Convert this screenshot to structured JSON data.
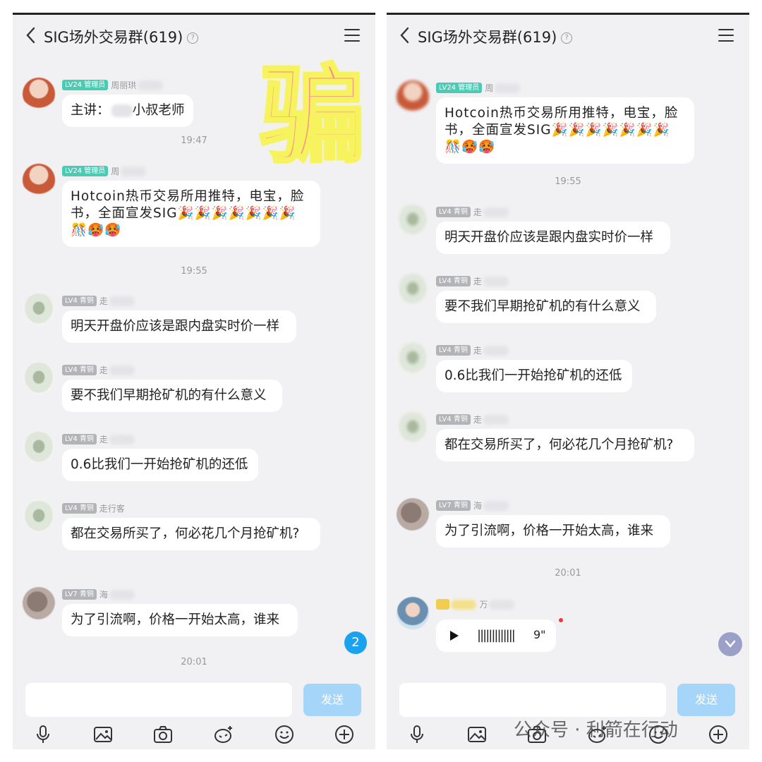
{
  "overlay_text": "骗",
  "colors": {
    "admin_badge": "#4ccbb4",
    "member_badge": "#b2b4b8",
    "send_button": "#a6d5fa",
    "unread_badge": "#1aa2ef"
  },
  "left": {
    "title": "SIG场外交易群(619)",
    "messages": [
      {
        "level": "LV24 管理员",
        "name": "周丽珙",
        "text": "主讲：",
        "text_tail": "小叔老师"
      },
      {
        "time": "19:47"
      },
      {
        "level": "LV24 管理员",
        "name": "周",
        "text": "Hotcoin热币交易所用推特，电宝，脸书，全面宣发SIG🎉🎉🎉🎉🎉🎉🎉🎊🥵🥵"
      },
      {
        "time": "19:55"
      },
      {
        "level": "LV4 青铜",
        "name": "走",
        "text": "明天开盘价应该是跟内盘实时价一样"
      },
      {
        "level": "LV4 青铜",
        "name": "走",
        "text": "要不我们早期抢矿机的有什么意义"
      },
      {
        "level": "LV4 青铜",
        "name": "走",
        "text": "0.6比我们一开始抢矿机的还低"
      },
      {
        "level": "LV4 青铜",
        "name": "走行客",
        "text": "都在交易所买了，何必花几个月抢矿机?"
      },
      {
        "level": "LV7 青铜",
        "name": "海",
        "text": "为了引流啊，价格一开始太高，谁来"
      },
      {
        "time": "20:01"
      }
    ],
    "unread_count": "2",
    "send_label": "发送"
  },
  "right": {
    "title": "SIG场外交易群(619)",
    "messages": [
      {
        "level": "LV24 管理员",
        "name": "周",
        "text": "Hotcoin热币交易所用推特，电宝，脸书，全面宣发SIG🎉🎉🎉🎉🎉🎉🎉🎊🥵🥵"
      },
      {
        "time": "19:55"
      },
      {
        "level": "LV4 青铜",
        "name": "走",
        "text": "明天开盘价应该是跟内盘实时价一样"
      },
      {
        "level": "LV4 青铜",
        "name": "走",
        "text": "要不我们早期抢矿机的有什么意义"
      },
      {
        "level": "LV4 青铜",
        "name": "走",
        "text": "0.6比我们一开始抢矿机的还低"
      },
      {
        "level": "LV4 青铜",
        "name": "走",
        "text": "都在交易所买了，何必花几个月抢矿机?"
      },
      {
        "level": "LV7 青铜",
        "name": "海",
        "text": "为了引流啊，价格一开始太高，谁来"
      },
      {
        "time": "20:01"
      },
      {
        "level": "LV",
        "name": "万",
        "voice_wave": "|||||||||||||",
        "voice_duration": "9\""
      }
    ],
    "send_label": "发送"
  },
  "watermark": "公众号 · 利箭在行动",
  "icons": [
    "back-icon",
    "menu-icon",
    "microphone-icon",
    "image-icon",
    "camera-icon",
    "sticker-icon",
    "emoji-icon",
    "plus-icon",
    "play-icon",
    "chevron-down-icon"
  ]
}
